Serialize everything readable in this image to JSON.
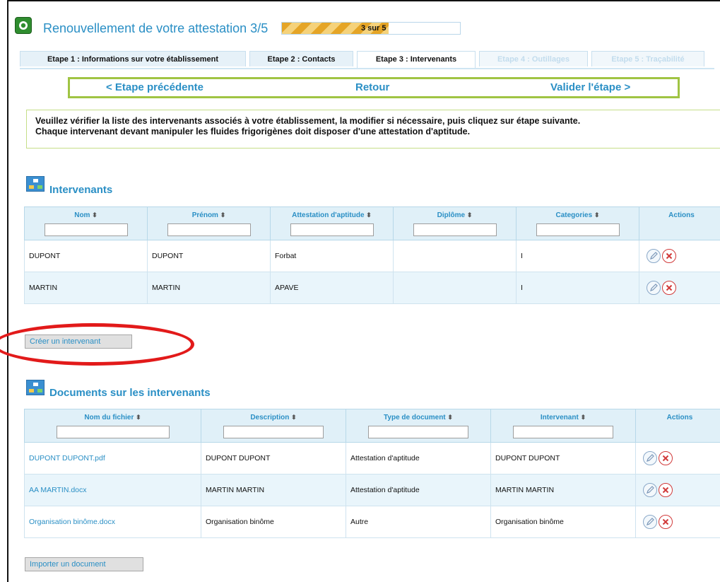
{
  "header": {
    "title": "Renouvellement de votre attestation 3/5",
    "progress_text": "3 sur 5",
    "progress_fraction": 0.6
  },
  "tabs": [
    {
      "label": "Etape 1 : Informations sur votre établissement",
      "state": "normal"
    },
    {
      "label": "Etape 2 : Contacts",
      "state": "normal"
    },
    {
      "label": "Etape 3 : Intervenants",
      "state": "active"
    },
    {
      "label": "Etape 4 : Outillages",
      "state": "disabled"
    },
    {
      "label": "Etape 5 : Traçabilité",
      "state": "disabled"
    }
  ],
  "nav": {
    "prev": "< Etape précédente",
    "back": "Retour",
    "next": "Valider l'étape >"
  },
  "info": {
    "line1": "Veuillez vérifier la liste des intervenants associés à votre établissement, la modifier si nécessaire, puis cliquez sur étape suivante.",
    "line2": "Chaque intervenant devant manipuler les fluides frigorigènes doit disposer d'une attestation d'aptitude."
  },
  "intervenants": {
    "title": "Intervenants",
    "columns": [
      "Nom",
      "Prénom",
      "Attestation d'aptitude",
      "Diplôme",
      "Categories",
      "Actions"
    ],
    "rows": [
      [
        "DUPONT",
        "DUPONT",
        "Forbat",
        "",
        "I"
      ],
      [
        "MARTIN",
        "MARTIN",
        "APAVE",
        "",
        "I"
      ]
    ],
    "create_button": "Créer un intervenant"
  },
  "documents": {
    "title": "Documents sur les intervenants",
    "columns": [
      "Nom du fichier",
      "Description",
      "Type de document",
      "Intervenant",
      "Actions"
    ],
    "rows": [
      [
        "DUPONT DUPONT.pdf",
        "DUPONT DUPONT",
        "Attestation d'aptitude",
        "DUPONT DUPONT"
      ],
      [
        "AA MARTIN.docx",
        "MARTIN MARTIN",
        "Attestation d'aptitude",
        "MARTIN MARTIN"
      ],
      [
        "Organisation binôme.docx",
        "Organisation binôme",
        "Autre",
        "Organisation binôme"
      ]
    ],
    "import_button": "Importer un document"
  },
  "colors": {
    "accent_blue": "#2a8fc5",
    "green_border": "#a0c443",
    "annotation_red": "#e21a1a",
    "progress_orange": "#e5a526"
  }
}
